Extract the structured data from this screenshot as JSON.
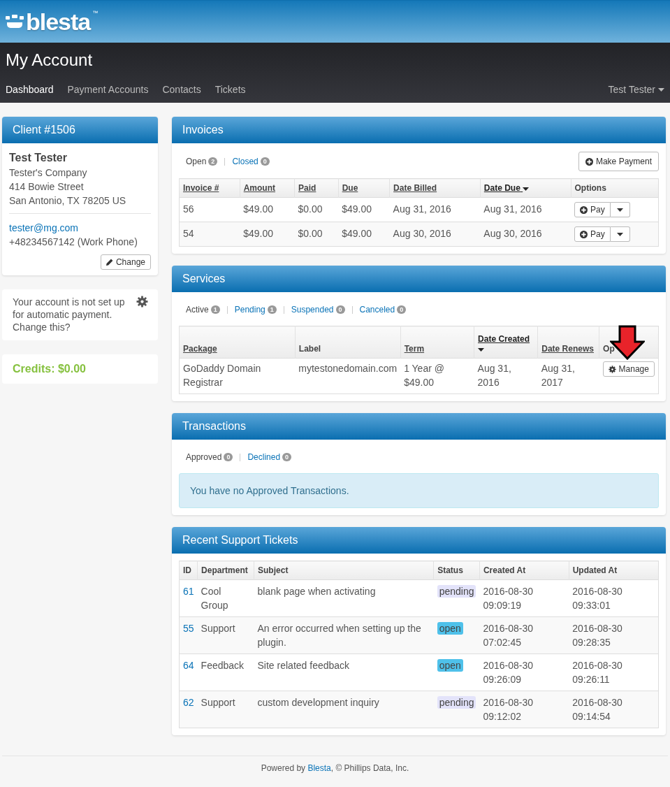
{
  "header": {
    "logo": {
      "text": "blesta",
      "mark": "™"
    }
  },
  "title": "My Account",
  "nav": {
    "items": [
      {
        "label": "Dashboard",
        "selected": true
      },
      {
        "label": "Payment Accounts",
        "selected": false
      },
      {
        "label": "Contacts",
        "selected": false
      },
      {
        "label": "Tickets",
        "selected": false
      }
    ],
    "user": "Test Tester"
  },
  "client": {
    "title": "Client #1506",
    "name": "Test Tester",
    "lines": [
      "Tester's Company",
      "414 Bowie Street",
      "San Antonio, TX 78205 US"
    ],
    "email": "tester@mg.com",
    "phone": "+48234567142 (Work Phone)",
    "change_button": "Change"
  },
  "autopay": {
    "text": "Your account is not set up for automatic payment. Change this?"
  },
  "credits": "Credits: $0.00",
  "invoices": {
    "title": "Invoices",
    "filters": [
      {
        "label": "Open",
        "count": "2",
        "selected": true
      },
      {
        "label": "Closed",
        "count": "0",
        "selected": false
      }
    ],
    "action": "Make Payment",
    "columns": [
      {
        "label": "Invoice #",
        "sortable": true,
        "sorted": false
      },
      {
        "label": "Amount",
        "sortable": true,
        "sorted": false
      },
      {
        "label": "Paid",
        "sortable": true,
        "sorted": false
      },
      {
        "label": "Due",
        "sortable": true,
        "sorted": false
      },
      {
        "label": "Date Billed",
        "sortable": true,
        "sorted": false
      },
      {
        "label": "Date Due",
        "sortable": true,
        "sorted": true
      },
      {
        "label": "Options",
        "sortable": false,
        "sorted": false
      }
    ],
    "rows": [
      {
        "cells": [
          "56",
          "$49.00",
          "$0.00",
          "$49.00",
          "Aug 31, 2016",
          "Aug 31, 2016"
        ],
        "button": "Pay"
      },
      {
        "cells": [
          "54",
          "$49.00",
          "$0.00",
          "$49.00",
          "Aug 30, 2016",
          "Aug 30, 2016"
        ],
        "button": "Pay"
      }
    ]
  },
  "services": {
    "title": "Services",
    "filters": [
      {
        "label": "Active",
        "count": "1",
        "selected": true
      },
      {
        "label": "Pending",
        "count": "1",
        "selected": false
      },
      {
        "label": "Suspended",
        "count": "0",
        "selected": false
      },
      {
        "label": "Canceled",
        "count": "0",
        "selected": false
      }
    ],
    "columns": [
      {
        "label": "Package",
        "sortable": true,
        "sorted": false
      },
      {
        "label": "Label",
        "sortable": false,
        "sorted": false
      },
      {
        "label": "Term",
        "sortable": true,
        "sorted": false
      },
      {
        "label": "Date Created",
        "sortable": true,
        "sorted": true
      },
      {
        "label": "Date Renews",
        "sortable": true,
        "sorted": false
      },
      {
        "label": "Op",
        "sortable": false,
        "sorted": false
      }
    ],
    "rows": [
      {
        "cells": [
          "GoDaddy Domain Registrar",
          "mytestonedomain.com",
          "1 Year @ $49.00",
          "Aug 31, 2016",
          "Aug 31, 2017"
        ],
        "button": "Manage"
      }
    ]
  },
  "transactions": {
    "title": "Transactions",
    "filters": [
      {
        "label": "Approved",
        "count": "0",
        "selected": true
      },
      {
        "label": "Declined",
        "count": "0",
        "selected": false
      }
    ],
    "notice": "You have no Approved Transactions."
  },
  "tickets": {
    "title": "Recent Support Tickets",
    "columns": [
      "ID",
      "Department",
      "Subject",
      "Status",
      "Created At",
      "Updated At"
    ],
    "rows": [
      {
        "id": "61",
        "department": "Cool Group",
        "subject": "blank page when activating",
        "status": {
          "text": "pending",
          "color": "#e3e3fa"
        },
        "created": "2016-08-30 09:09:19",
        "updated": "2016-08-30 09:33:01"
      },
      {
        "id": "55",
        "department": "Support",
        "subject": "An error occurred when setting up the plugin.",
        "status": {
          "text": "open",
          "color": "#4fc1ea"
        },
        "created": "2016-08-30 07:02:45",
        "updated": "2016-08-30 09:28:35"
      },
      {
        "id": "64",
        "department": "Feedback",
        "subject": "Site related feedback",
        "status": {
          "text": "open",
          "color": "#4fc1ea"
        },
        "created": "2016-08-30 09:26:09",
        "updated": "2016-08-30 09:26:11"
      },
      {
        "id": "62",
        "department": "Support",
        "subject": "custom development inquiry",
        "status": {
          "text": "pending",
          "color": "#e3e3fa"
        },
        "created": "2016-08-30 09:12:02",
        "updated": "2016-08-30 09:14:54"
      }
    ]
  },
  "footer": {
    "prefix": "Powered by ",
    "link": "Blesta",
    "suffix": ", © Phillips Data, Inc."
  }
}
